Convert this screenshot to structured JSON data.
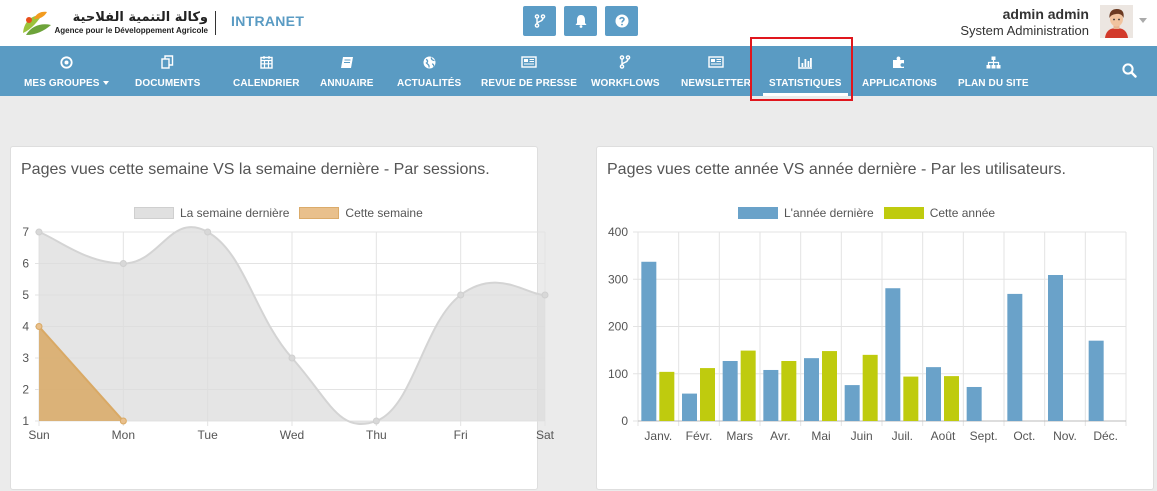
{
  "header": {
    "logo_arabic": "وكالة التنمية الفلاحية",
    "logo_french": "Agence pour le Développement Agricole",
    "app_name": "INTRANET",
    "buttons": [
      {
        "icon": "workflow-icon"
      },
      {
        "icon": "bell-icon"
      },
      {
        "icon": "question-icon"
      }
    ],
    "user": {
      "name": "admin admin",
      "role": "System Administration"
    }
  },
  "nav": {
    "items": [
      {
        "label": "MES GROUPES",
        "icon": "target-icon"
      },
      {
        "label": "DOCUMENTS",
        "icon": "documents-icon"
      },
      {
        "label": "CALENDRIER",
        "icon": "calendar-icon"
      },
      {
        "label": "ANNUAIRE",
        "icon": "book-icon"
      },
      {
        "label": "ACTUALITÉS",
        "icon": "globe-icon"
      },
      {
        "label": "REVUE DE PRESSE",
        "icon": "newspaper-icon"
      },
      {
        "label": "WORKFLOWS",
        "icon": "workflow-icon"
      },
      {
        "label": "NEWSLETTER",
        "icon": "newspaper-icon"
      },
      {
        "label": "STATISTIQUES",
        "icon": "bar-chart-icon",
        "active": true
      },
      {
        "label": "APPLICATIONS",
        "icon": "puzzle-icon"
      },
      {
        "label": "PLAN DU SITE",
        "icon": "sitemap-icon"
      }
    ],
    "search_icon": "search-icon"
  },
  "colors": {
    "nav_bg": "#5a9bc3",
    "last_week": "#e0e0e0",
    "this_week": "#d9a965",
    "last_year": "#6aa2c9",
    "this_year": "#bfcb0e",
    "highlight": "#e0161d"
  },
  "chart_data": [
    {
      "type": "area",
      "title": "Pages vues cette semaine VS la semaine dernière - Par sessions.",
      "categories": [
        "Sun",
        "Mon",
        "Tue",
        "Wed",
        "Thu",
        "Fri",
        "Sat"
      ],
      "series": [
        {
          "name": "La semaine dernière",
          "values": [
            7,
            6,
            7,
            3,
            1,
            5,
            5
          ]
        },
        {
          "name": "Cette semaine",
          "values": [
            4,
            1
          ]
        }
      ],
      "ylim": [
        1,
        7
      ],
      "yticks": [
        1,
        2,
        3,
        4,
        5,
        6,
        7
      ],
      "grid": true,
      "legend": "top"
    },
    {
      "type": "bar",
      "title": "Pages vues cette année VS année dernière - Par les utilisateurs.",
      "categories": [
        "Janv.",
        "Févr.",
        "Mars",
        "Avr.",
        "Mai",
        "Juin",
        "Juil.",
        "Août",
        "Sept.",
        "Oct.",
        "Nov.",
        "Déc."
      ],
      "series": [
        {
          "name": "L'année dernière",
          "values": [
            337,
            58,
            127,
            108,
            133,
            76,
            281,
            114,
            72,
            269,
            309,
            170
          ]
        },
        {
          "name": "Cette année",
          "values": [
            104,
            112,
            149,
            127,
            148,
            140,
            94,
            95,
            null,
            null,
            null,
            null
          ]
        }
      ],
      "ylim": [
        0,
        400
      ],
      "yticks": [
        0,
        100,
        200,
        300,
        400
      ],
      "grid": true,
      "legend": "top"
    }
  ]
}
